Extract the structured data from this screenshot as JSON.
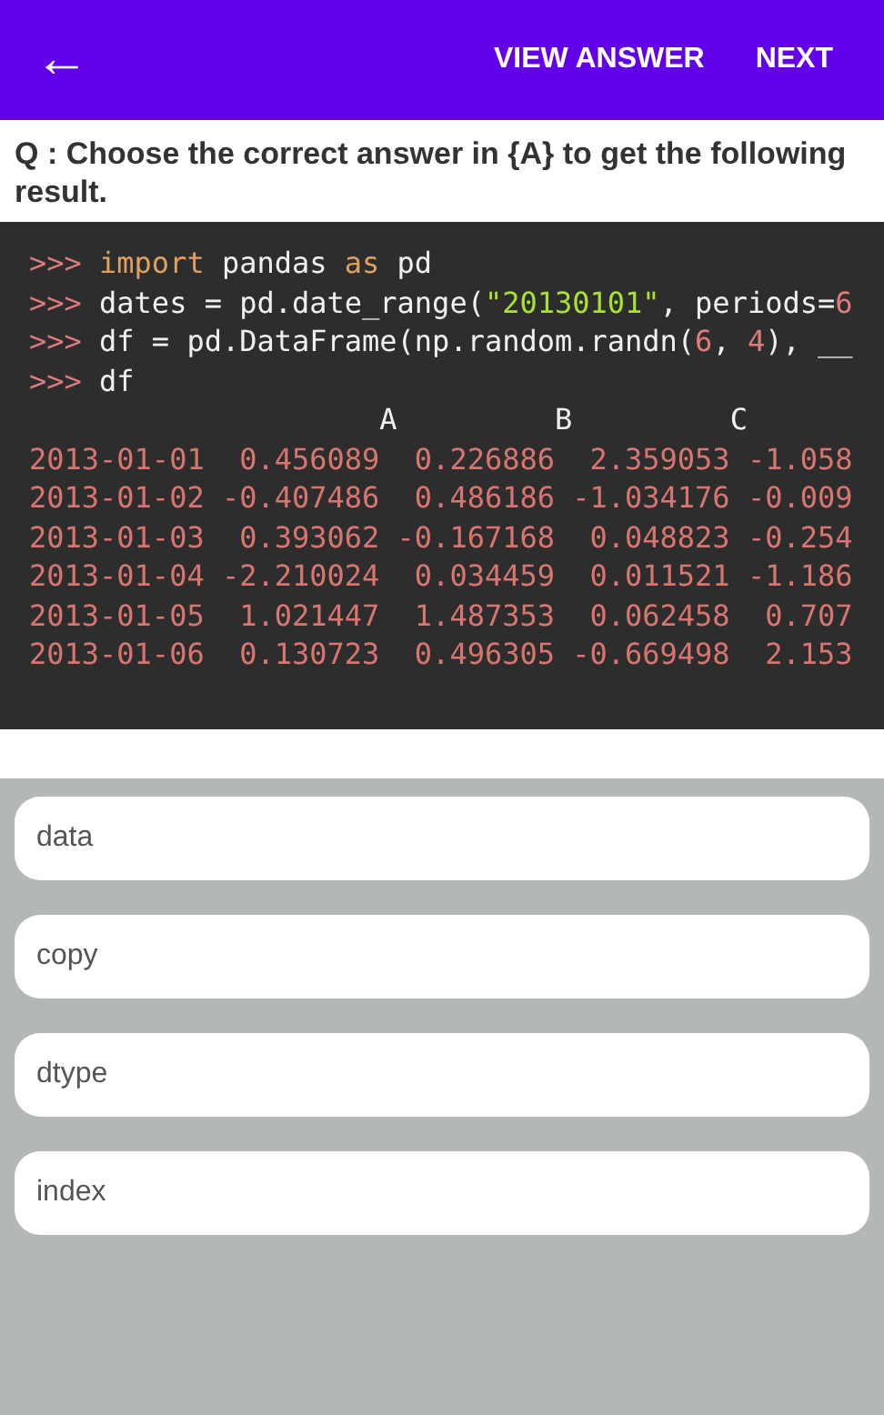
{
  "app_bar": {
    "back_icon": "←",
    "actions": [
      "VIEW ANSWER",
      "NEXT"
    ]
  },
  "question": "Q : Choose the correct answer in {A} to get the following result.",
  "code_lines": [
    [
      {
        "kind": "prompt",
        "text": ">>> "
      },
      {
        "kind": "keyword",
        "text": "import"
      },
      {
        "kind": "plain",
        "text": " pandas "
      },
      {
        "kind": "keyword",
        "text": "as"
      },
      {
        "kind": "plain",
        "text": " pd"
      }
    ],
    [
      {
        "kind": "prompt",
        "text": ">>> "
      },
      {
        "kind": "plain",
        "text": "dates = pd.date_range("
      },
      {
        "kind": "string",
        "text": "\"20130101\""
      },
      {
        "kind": "plain",
        "text": ", periods="
      },
      {
        "kind": "number",
        "text": "6"
      }
    ],
    [
      {
        "kind": "prompt",
        "text": ">>> "
      },
      {
        "kind": "plain",
        "text": "df = pd.DataFrame(np.random.randn("
      },
      {
        "kind": "number",
        "text": "6"
      },
      {
        "kind": "plain",
        "text": ", "
      },
      {
        "kind": "number",
        "text": "4"
      },
      {
        "kind": "plain",
        "text": "), __"
      }
    ],
    [
      {
        "kind": "prompt",
        "text": ">>> "
      },
      {
        "kind": "plain",
        "text": "df"
      }
    ],
    [
      {
        "kind": "plain",
        "text": "                    A         B         C"
      }
    ],
    [
      {
        "kind": "output",
        "text": "2013-01-01  0.456089  0.226886  2.359053 -1.058"
      }
    ],
    [
      {
        "kind": "output",
        "text": "2013-01-02 -0.407486  0.486186 -1.034176 -0.009"
      }
    ],
    [
      {
        "kind": "output",
        "text": "2013-01-03  0.393062 -0.167168  0.048823 -0.254"
      }
    ],
    [
      {
        "kind": "output",
        "text": "2013-01-04 -2.210024  0.034459  0.011521 -1.186"
      }
    ],
    [
      {
        "kind": "output",
        "text": "2013-01-05  1.021447  1.487353  0.062458  0.707"
      }
    ],
    [
      {
        "kind": "output",
        "text": "2013-01-06  0.130723  0.496305 -0.669498  2.153"
      }
    ]
  ],
  "options": [
    "data",
    "copy",
    "dtype",
    "index"
  ]
}
